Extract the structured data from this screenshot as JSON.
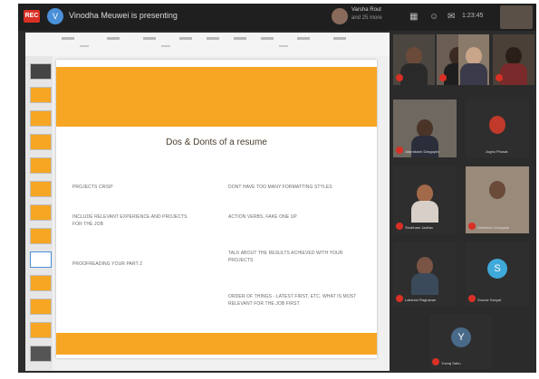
{
  "meeting": {
    "rec_label": "REC",
    "presenter_initial": "V",
    "presenting_text": "Vinodha Meuwei is presenting",
    "host_name": "Varsha Rout",
    "host_sub": "and 25 more",
    "time": "1:23:45"
  },
  "slide": {
    "title": "Dos & Donts of a resume",
    "left_items": [
      "Projects crisp",
      "Include relevant experience and projects for the job",
      "Proofreading your part 2"
    ],
    "right_items": [
      "Dont have too many formatting styles",
      "Action verbs, fake one up",
      "Talk about the results achieved with your projects",
      "Order of things - latest first, etc. what is most relevant for the job first"
    ]
  },
  "participants": [
    {
      "name": "",
      "initial": ""
    },
    {
      "name": "",
      "initial": ""
    },
    {
      "name": "",
      "initial": ""
    },
    {
      "name": "",
      "initial": ""
    },
    {
      "name": "Jaiprakash Dasgupta",
      "initial": ""
    },
    {
      "name": "Jugnu Phosat",
      "initial": ""
    },
    {
      "name": "Shubham Jadhav",
      "initial": ""
    },
    {
      "name": "Abhishek Chorgade",
      "initial": ""
    },
    {
      "name": "Lakshmi Raghavan",
      "initial": ""
    },
    {
      "name": "Sourav Sanyal",
      "initial": "S"
    },
    {
      "name": "Yuvraj Sahu",
      "initial": "Y"
    }
  ],
  "colors": {
    "accent": "#f6a623",
    "rec": "#d93025",
    "mute": "#d93025"
  }
}
